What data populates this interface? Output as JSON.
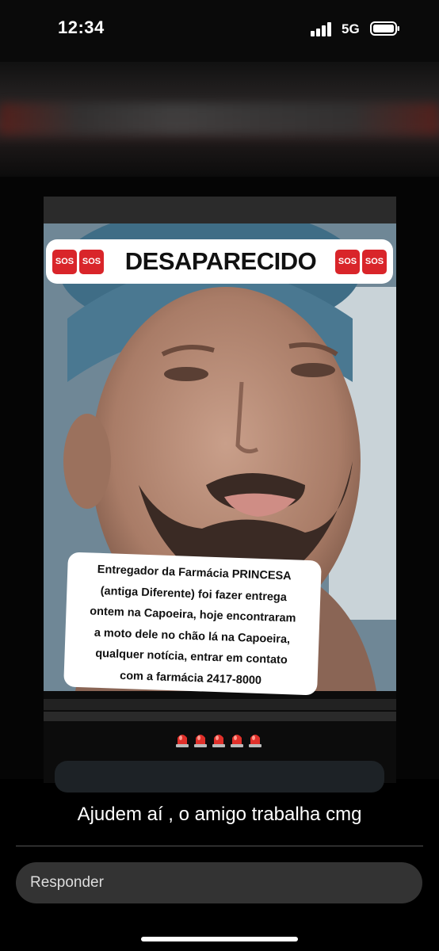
{
  "status": {
    "time": "12:34",
    "network": "5G"
  },
  "post": {
    "banner": {
      "badge_text": "SOS",
      "title": "DESAPARECIDO"
    },
    "caption_lines": [
      "Entregador da Farmácia PRINCESA",
      "(antiga Diferente) foi fazer entrega",
      "ontem na Capoeira, hoje encontraram",
      "a moto dele no chão lá na Capoeira,",
      "qualquer notícia, entrar em contato",
      "com a farmácia 2417-8000"
    ],
    "alarm_icons": [
      "siren-icon",
      "siren-icon",
      "siren-icon",
      "siren-icon",
      "siren-icon"
    ]
  },
  "comment": {
    "text": "Ajudem aí , o amigo trabalha cmg"
  },
  "reply": {
    "placeholder": "Responder"
  },
  "colors": {
    "sos_red": "#d9252a",
    "background": "#000000",
    "reply_field": "#333333"
  }
}
